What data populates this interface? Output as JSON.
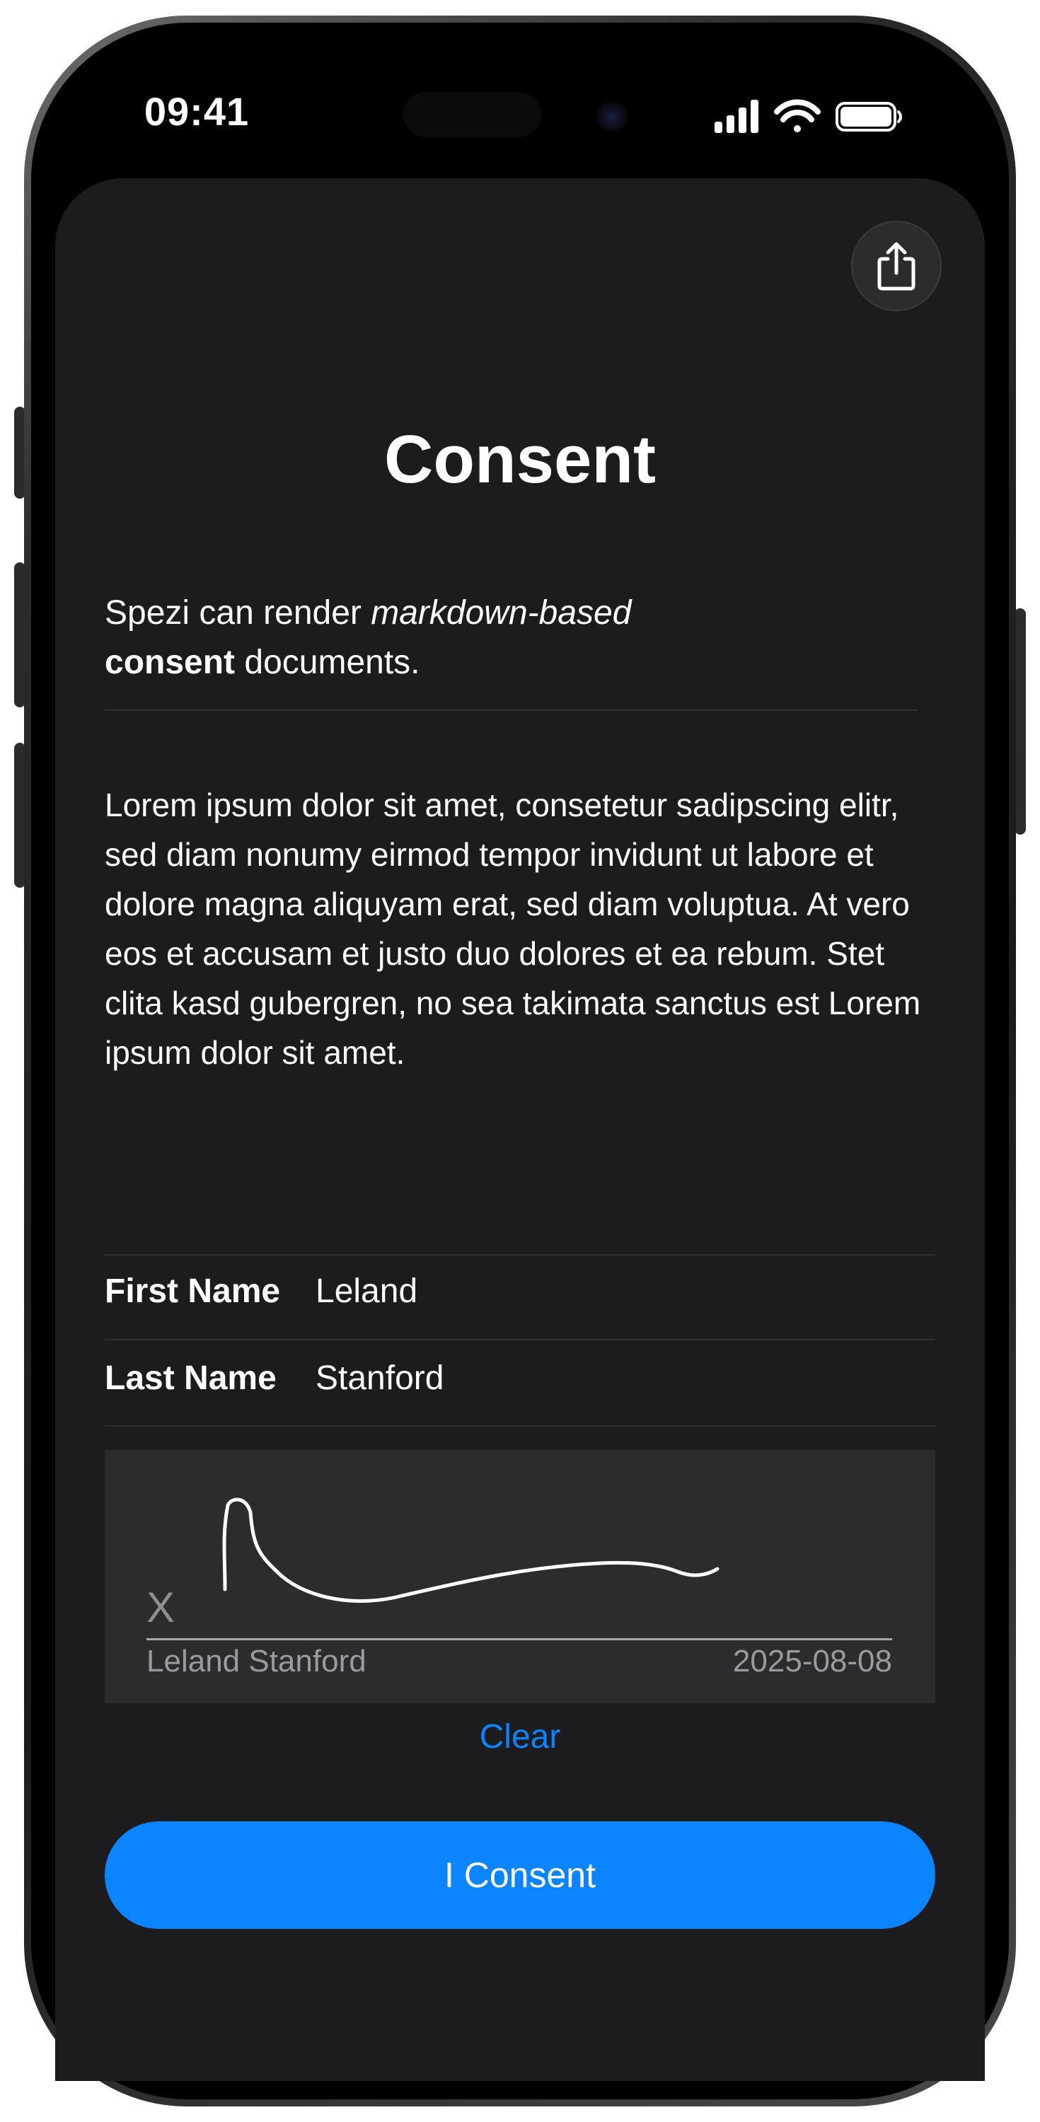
{
  "status_bar": {
    "time": "09:41",
    "icons": [
      "cellular-signal-icon",
      "wifi-icon",
      "battery-icon"
    ]
  },
  "toolbar": {
    "share_icon": "share-icon"
  },
  "page": {
    "title": "Consent",
    "intro_part1": "Spezi can render ",
    "intro_italic": "markdown-based",
    "intro_bold": "consent",
    "intro_part2": " documents.",
    "body": "Lorem ipsum dolor sit amet, consetetur sadipscing elitr, sed diam nonumy eirmod tempor invidunt ut labore et dolore magna aliquyam erat, sed diam voluptua. At vero eos et accusam et justo duo dolores et ea rebum. Stet clita kasd gubergren, no sea takimata sanctus est Lorem ipsum dolor sit amet."
  },
  "form": {
    "first_name_label": "First Name",
    "first_name_value": "Leland",
    "last_name_label": "Last Name",
    "last_name_value": "Stanford"
  },
  "signature": {
    "x_marker": "X",
    "signer_name": "Leland Stanford",
    "date": "2025-08-08",
    "clear_label": "Clear"
  },
  "actions": {
    "consent_label": "I Consent"
  },
  "colors": {
    "accent": "#0a84ff",
    "sheet_background": "#1c1c1e",
    "signature_background": "#2c2c2e"
  }
}
